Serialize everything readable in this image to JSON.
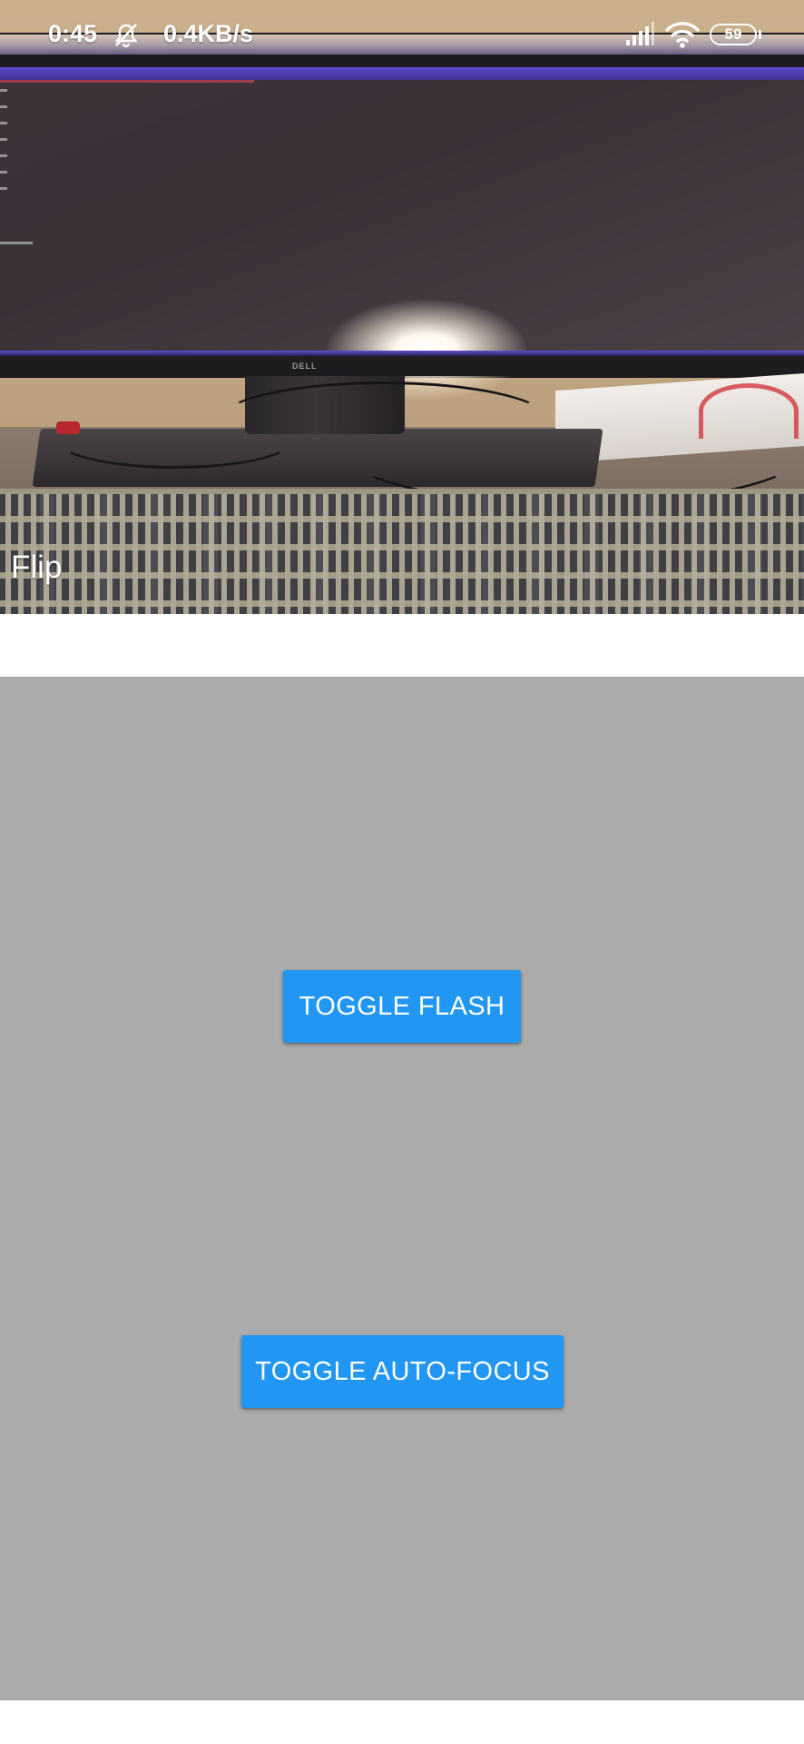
{
  "status_bar": {
    "time": "0:45",
    "network_speed": "0.4KB/s",
    "battery_level": "59",
    "icons": [
      "mute-icon",
      "signal-icon",
      "wifi-icon",
      "battery-icon"
    ]
  },
  "camera_preview": {
    "flip_label": "Flip"
  },
  "controls": {
    "toggle_flash_label": "TOGGLE FLASH",
    "toggle_autofocus_label": "TOGGLE AUTO-FOCUS"
  },
  "colors": {
    "button": "#2196f3",
    "controls_background": "#ababab",
    "page_background": "#ffffff"
  }
}
